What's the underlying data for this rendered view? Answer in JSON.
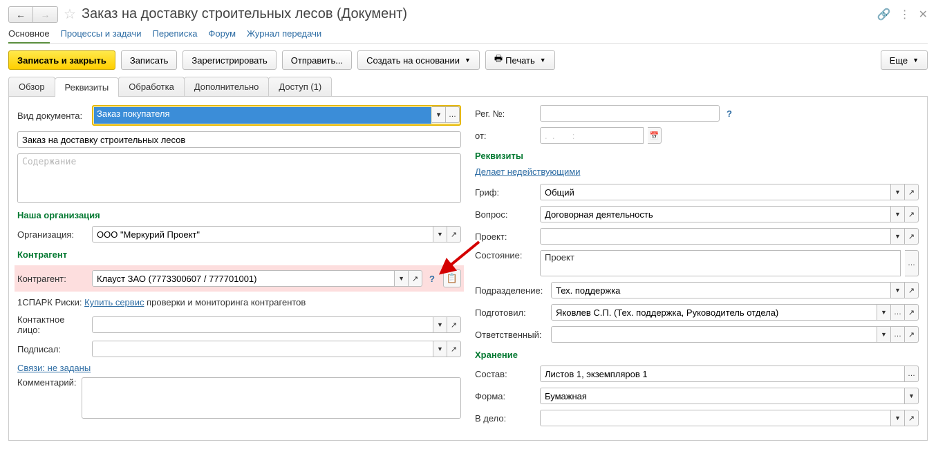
{
  "header": {
    "title": "Заказ на доставку строительных лесов (Документ)"
  },
  "tabs1": {
    "main": "Основное",
    "processes": "Процессы и задачи",
    "corr": "Переписка",
    "forum": "Форум",
    "transfer": "Журнал передачи"
  },
  "toolbar": {
    "save_close": "Записать и закрыть",
    "save": "Записать",
    "register": "Зарегистрировать",
    "send": "Отправить...",
    "create_from": "Создать на основании",
    "print": "Печать",
    "more": "Еще"
  },
  "tabs2": {
    "overview": "Обзор",
    "details": "Реквизиты",
    "processing": "Обработка",
    "additional": "Дополнительно",
    "access": "Доступ (1)"
  },
  "left": {
    "doc_type_label": "Вид документа:",
    "doc_type_value": "Заказ покупателя",
    "doc_name": "Заказ на доставку строительных лесов",
    "content_placeholder": "Содержание",
    "our_org_section": "Наша организация",
    "org_label": "Организация:",
    "org_value": "ООО \"Меркурий Проект\"",
    "counterparty_section": "Контрагент",
    "counterparty_label": "Контрагент:",
    "counterparty_value": "Клауст ЗАО (7773300607 / 777701001)",
    "spark_prefix": "1СПАРК Риски:",
    "spark_link": "Купить сервис",
    "spark_suffix": "проверки и мониторинга контрагентов",
    "contact_label": "Контактное лицо:",
    "signed_label": "Подписал:",
    "links": "Связи: не заданы",
    "comment_label": "Комментарий:"
  },
  "right": {
    "reg_no_label": "Рег. №:",
    "from_label": "от:",
    "date_placeholder": ".  .       :",
    "details_section": "Реквизиты",
    "inactive_link": "Делает недействующими",
    "grif_label": "Гриф:",
    "grif_value": "Общий",
    "question_label": "Вопрос:",
    "question_value": "Договорная деятельность",
    "project_label": "Проект:",
    "state_label": "Состояние:",
    "state_value": "Проект",
    "dept_label": "Подразделение:",
    "dept_value": "Тех. поддержка",
    "prepared_label": "Подготовил:",
    "prepared_value": "Яковлев С.П. (Тех. поддержка, Руководитель отдела)",
    "responsible_label": "Ответственный:",
    "storage_section": "Хранение",
    "composition_label": "Состав:",
    "composition_value": "Листов 1, экземпляров 1",
    "form_label": "Форма:",
    "form_value": "Бумажная",
    "in_file_label": "В дело:"
  }
}
